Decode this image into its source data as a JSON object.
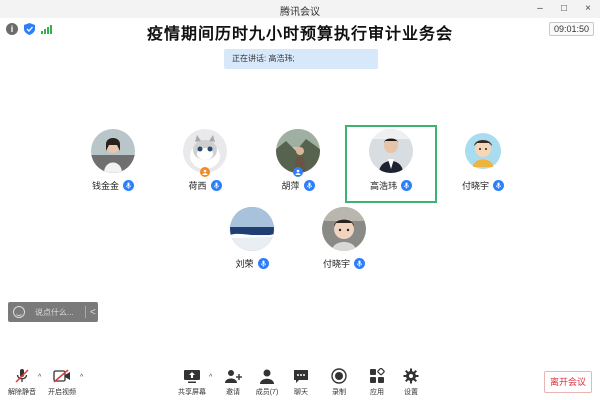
{
  "window": {
    "title": "腾讯会议",
    "controls": [
      "–",
      "□",
      "×"
    ]
  },
  "meeting": {
    "title": "疫情期间历时九小时预算执行审计业务会",
    "timer": "09:01:50"
  },
  "speaking": {
    "label": "正在讲话: 高浩玮;"
  },
  "participants": [
    {
      "name": "钱金金",
      "mic_icon": "mic-icon",
      "host": false
    },
    {
      "name": "荷西",
      "mic_icon": "mic-icon",
      "host": true
    },
    {
      "name": "胡萍",
      "mic_icon": "mic-icon",
      "host": true
    },
    {
      "name": "高浩玮",
      "mic_icon": "mic-icon",
      "host": false,
      "active": true
    },
    {
      "name": "付晓宇",
      "mic_icon": "mic-icon",
      "host": false
    },
    {
      "name": "刘荣",
      "mic_icon": "mic-icon",
      "host": false
    },
    {
      "name": "付晓宇",
      "mic_icon": "mic-icon",
      "host": false
    }
  ],
  "chat": {
    "placeholder": "说点什么...",
    "collapse": "<"
  },
  "toolbar": {
    "mute": "解除静音",
    "video": "开启视频",
    "share": "共享屏幕",
    "invite": "邀请",
    "members": "成员(7)",
    "chat": "聊天",
    "record": "录制",
    "apps": "应用",
    "settings": "设置",
    "leave": "离开会议"
  },
  "colors": {
    "accent": "#2d7ff9",
    "active_border": "#3cb371",
    "leave": "#d9303a",
    "signal": "#2fb34a"
  }
}
